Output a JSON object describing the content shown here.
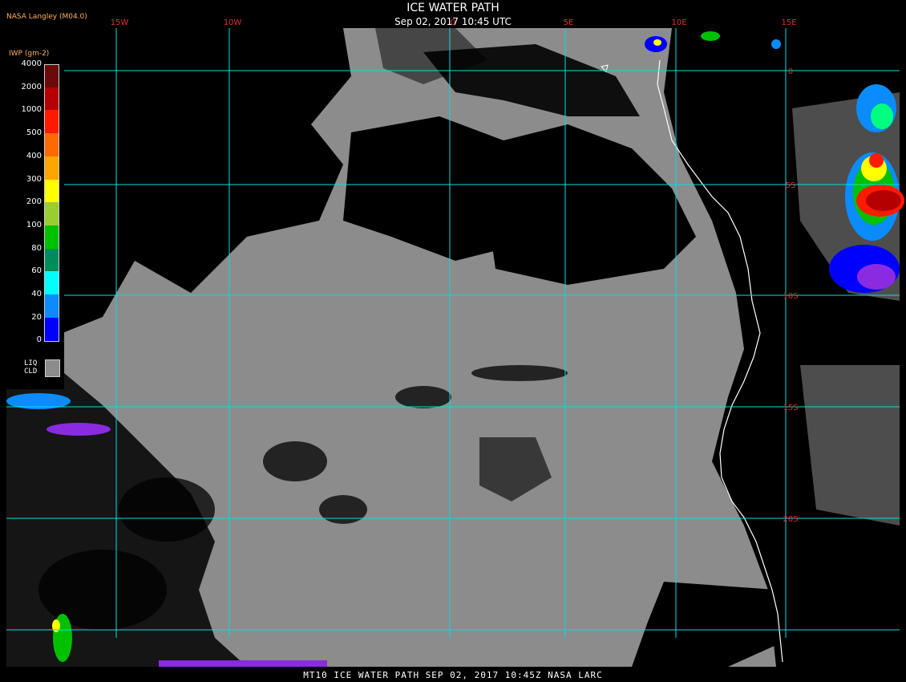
{
  "header": {
    "title": "ICE WATER PATH",
    "subtitle": "Sep 02, 2017 10:45 UTC",
    "producer": "NASA Langley (M04.0)"
  },
  "footer": {
    "text": "MT10  ICE WATER PATH   SEP 02, 2017 10:45Z   NASA LARC"
  },
  "colors": {
    "background": "#000000",
    "liquid_cloud": "#8c8c8c",
    "grid": "#00e0e0",
    "grid_label": "#e03030",
    "coastline": "#ffffff",
    "title_text": "#ffffff",
    "legend_text": "#ffb060"
  },
  "grid": {
    "longitude_labels": [
      "15W",
      "10W",
      "0",
      "5E",
      "10E",
      "15E"
    ],
    "latitude_labels": [
      "0",
      "5S",
      "10S",
      "15S",
      "20S"
    ]
  },
  "legend": {
    "title": "IWP (gm-2)",
    "labels": [
      "4000",
      "2000",
      "1000",
      "500",
      "400",
      "300",
      "200",
      "100",
      "80",
      "60",
      "40",
      "20",
      "0"
    ],
    "colors": [
      "#6b0a0a",
      "#b40000",
      "#ff1a00",
      "#ff6a00",
      "#ffa500",
      "#ffff00",
      "#9acd32",
      "#00c000",
      "#008c5a",
      "#00ffff",
      "#0a8cff",
      "#0000ff",
      "#8a2be2"
    ],
    "liq_label": "LIQ",
    "cld_label": "CLD"
  }
}
